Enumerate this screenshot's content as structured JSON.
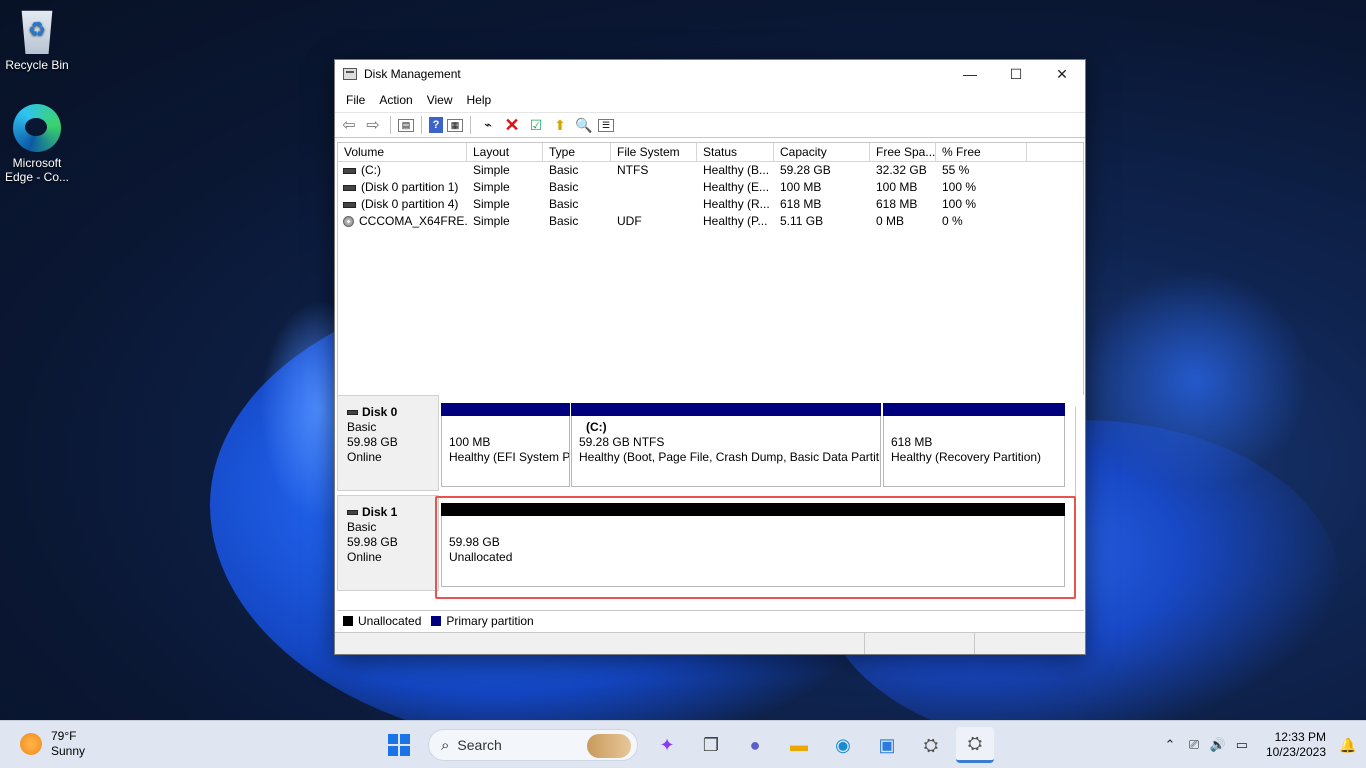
{
  "desktop": {
    "icons": [
      {
        "label": "Recycle Bin",
        "icon": "recycle-bin-icon"
      },
      {
        "label": "Microsoft Edge - Co...",
        "icon": "edge-icon"
      }
    ]
  },
  "window": {
    "title": "Disk Management",
    "controls": {
      "minimize": "—",
      "maximize": "☐",
      "close": "✕"
    },
    "menu": [
      "File",
      "Action",
      "View",
      "Help"
    ],
    "volume_table": {
      "columns": [
        "Volume",
        "Layout",
        "Type",
        "File System",
        "Status",
        "Capacity",
        "Free Spa...",
        "% Free"
      ],
      "rows": [
        {
          "volume": "(C:)",
          "layout": "Simple",
          "type": "Basic",
          "fs": "NTFS",
          "status": "Healthy (B...",
          "capacity": "59.28 GB",
          "free": "32.32 GB",
          "pct": "55 %",
          "icon": "drive-icon"
        },
        {
          "volume": "(Disk 0 partition 1)",
          "layout": "Simple",
          "type": "Basic",
          "fs": "",
          "status": "Healthy (E...",
          "capacity": "100 MB",
          "free": "100 MB",
          "pct": "100 %",
          "icon": "drive-icon"
        },
        {
          "volume": "(Disk 0 partition 4)",
          "layout": "Simple",
          "type": "Basic",
          "fs": "",
          "status": "Healthy (R...",
          "capacity": "618 MB",
          "free": "618 MB",
          "pct": "100 %",
          "icon": "drive-icon"
        },
        {
          "volume": "CCCOMA_X64FRE...",
          "layout": "Simple",
          "type": "Basic",
          "fs": "UDF",
          "status": "Healthy (P...",
          "capacity": "5.11 GB",
          "free": "0 MB",
          "pct": "0 %",
          "icon": "cd-drive-icon"
        }
      ]
    },
    "disks": [
      {
        "name": "Disk 0",
        "type": "Basic",
        "size": "59.98 GB",
        "state": "Online",
        "partitions": [
          {
            "label": "",
            "size": "100 MB",
            "status": "Healthy (EFI System P",
            "kind": "primary"
          },
          {
            "label": "(C:)",
            "size": "59.28 GB NTFS",
            "status": "Healthy (Boot, Page File, Crash Dump, Basic Data Partitic",
            "kind": "primary"
          },
          {
            "label": "",
            "size": "618 MB",
            "status": "Healthy (Recovery Partition)",
            "kind": "primary"
          }
        ]
      },
      {
        "name": "Disk 1",
        "type": "Basic",
        "size": "59.98 GB",
        "state": "Online",
        "partitions": [
          {
            "label": "",
            "size": "59.98 GB",
            "status": "Unallocated",
            "kind": "unallocated"
          }
        ]
      }
    ],
    "legend": [
      {
        "label": "Unallocated",
        "color": "#000000"
      },
      {
        "label": "Primary partition",
        "color": "#00007f"
      }
    ]
  },
  "taskbar": {
    "weather": {
      "temp": "79°F",
      "condition": "Sunny"
    },
    "search_label": "Search",
    "clock": {
      "time": "12:33 PM",
      "date": "10/23/2023"
    },
    "colors": {
      "accent": "#1a74e8",
      "highlight": "#e8534f"
    }
  }
}
